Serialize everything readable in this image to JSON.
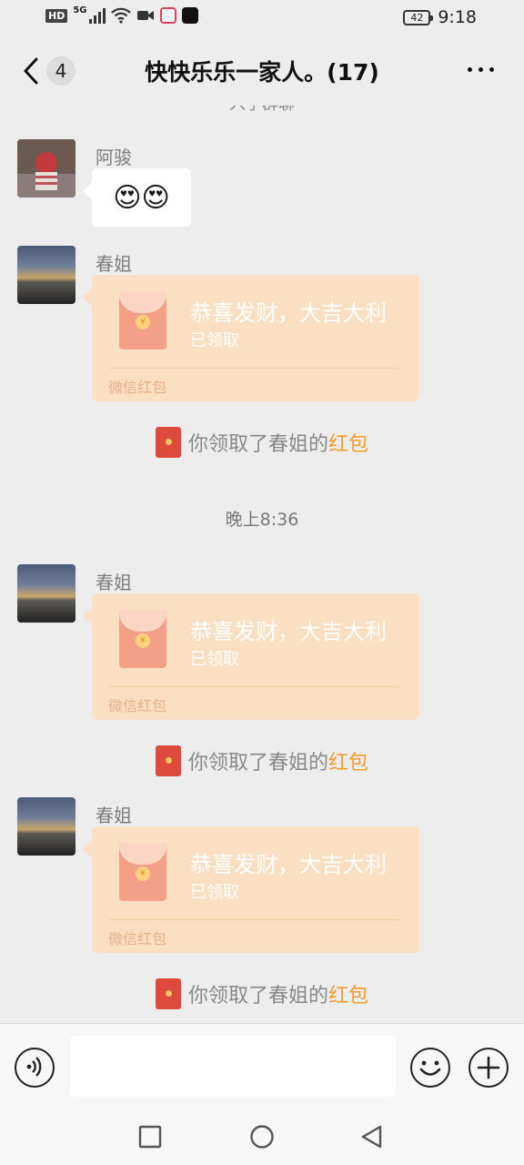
{
  "status_bar": {
    "network_hd": "HD",
    "network_gen": "5G",
    "battery_level": "42",
    "time": "9:18"
  },
  "header": {
    "unread_count": "4",
    "title": "快快乐乐一家人。(17)"
  },
  "chat": {
    "system_text_top": "入了群聊",
    "messages": [
      {
        "sender": "阿骏",
        "type": "emoji",
        "content": "😍😍"
      },
      {
        "sender": "春姐",
        "type": "red_packet",
        "title": "恭喜发财，大吉大利",
        "status": "已领取",
        "label": "微信红包",
        "notice_prefix": "你领取了春姐的",
        "notice_link": "红包"
      },
      {
        "timestamp": "晚上8:36"
      },
      {
        "sender": "春姐",
        "type": "red_packet",
        "title": "恭喜发财，大吉大利",
        "status": "已领取",
        "label": "微信红包",
        "notice_prefix": "你领取了春姐的",
        "notice_link": "红包"
      },
      {
        "sender": "春姐",
        "type": "red_packet",
        "title": "恭喜发财，大吉大利",
        "status": "已领取",
        "label": "微信红包",
        "notice_prefix": "你领取了春姐的",
        "notice_link": "红包"
      }
    ]
  },
  "input_bar": {
    "value": ""
  },
  "colors": {
    "background": "#ededed",
    "red_packet_card": "#fbdfc2",
    "red_packet_link": "#f59b2b",
    "red_packet_icon": "#de4a3b"
  }
}
